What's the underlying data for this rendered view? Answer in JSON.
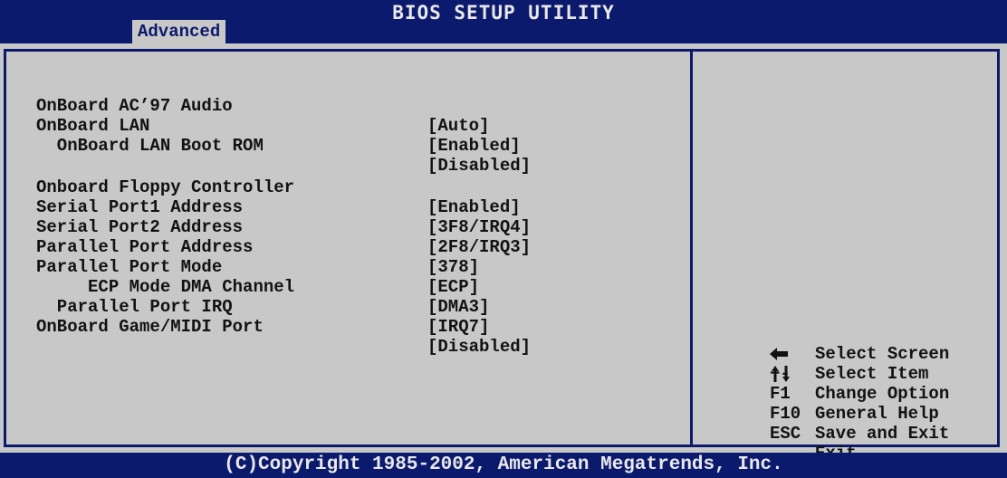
{
  "header": {
    "title": "BIOS SETUP UTILITY",
    "active_tab": "Advanced"
  },
  "settings": [
    {
      "label": "OnBoard AC’97 Audio",
      "value": "[Auto]"
    },
    {
      "label": "OnBoard LAN",
      "value": "[Enabled]"
    },
    {
      "label": "  OnBoard LAN Boot ROM",
      "value": "[Disabled]"
    },
    {
      "label": "Onboard Floppy Controller",
      "value": "[Enabled]"
    },
    {
      "label": "Serial Port1 Address",
      "value": "[3F8/IRQ4]"
    },
    {
      "label": "Serial Port2 Address",
      "value": "[2F8/IRQ3]"
    },
    {
      "label": "Parallel Port Address",
      "value": "[378]"
    },
    {
      "label": "Parallel Port Mode",
      "value": "[ECP]"
    },
    {
      "label": "     ECP Mode DMA Channel",
      "value": "[DMA3]"
    },
    {
      "label": "  Parallel Port IRQ",
      "value": "[IRQ7]"
    },
    {
      "label": "OnBoard Game/MIDI Port",
      "value": "[Disabled]"
    }
  ],
  "help": [
    {
      "key": "left-arrow-icon",
      "desc": "Select Screen"
    },
    {
      "key": "up-down-arrows-icon",
      "desc": "Select Item"
    },
    {
      "key": "+-",
      "desc": "Change Option"
    },
    {
      "key": "F1",
      "desc": "General Help"
    },
    {
      "key": "F10",
      "desc": "Save and Exit"
    },
    {
      "key": "ESC",
      "desc": "Exit"
    }
  ],
  "footer": {
    "copyright": "(C)Copyright 1985-2002, American Megatrends, Inc."
  },
  "colors": {
    "bios_blue": "#0c1a6e",
    "bios_gray": "#c8c8c8",
    "text": "#121212"
  }
}
